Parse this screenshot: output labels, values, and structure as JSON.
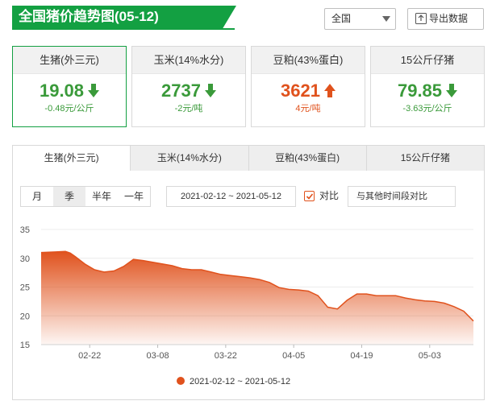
{
  "header": {
    "title": "全国猪价趋势图(05-12)",
    "region": "全国",
    "export_label": "导出数据"
  },
  "cards": [
    {
      "name": "生猪(外三元)",
      "value": "19.08",
      "change": "-0.48元/公斤",
      "direction": "down",
      "color": "#3a9a3a"
    },
    {
      "name": "玉米(14%水分)",
      "value": "2737",
      "change": "-2元/吨",
      "direction": "down",
      "color": "#3a9a3a"
    },
    {
      "name": "豆粕(43%蛋白)",
      "value": "3621",
      "change": "4元/吨",
      "direction": "up",
      "color": "#e0521d"
    },
    {
      "name": "15公斤仔猪",
      "value": "79.85",
      "change": "-3.63元/公斤",
      "direction": "down",
      "color": "#3a9a3a"
    }
  ],
  "tabs": [
    "生猪(外三元)",
    "玉米(14%水分)",
    "豆粕(43%蛋白)",
    "15公斤仔猪"
  ],
  "controls": {
    "periods": [
      "月",
      "季",
      "半年",
      "一年"
    ],
    "active_period": "季",
    "date_range": "2021-02-12 ~ 2021-05-12",
    "compare_label": "对比",
    "compare_checked": true,
    "compare_other": "与其他时间段对比"
  },
  "colors": {
    "brand_green": "#13a042",
    "down_green": "#3a9a3a",
    "up_orange": "#e0521d"
  },
  "chart_data": {
    "type": "area",
    "ylim": [
      15,
      35
    ],
    "yticks": [
      15,
      20,
      25,
      30,
      35
    ],
    "xticks": [
      "02-22",
      "03-08",
      "03-22",
      "04-05",
      "04-19",
      "05-03"
    ],
    "xlim": [
      "2021-02-12",
      "2021-05-12"
    ],
    "grid": "horizontal",
    "legend": "bottom-center",
    "series": [
      {
        "name": "2021-02-12 ~ 2021-05-12",
        "color": "#e0521d",
        "x": [
          "2021-02-12",
          "2021-02-15",
          "2021-02-17",
          "2021-02-18",
          "2021-02-19",
          "2021-02-21",
          "2021-02-23",
          "2021-02-25",
          "2021-02-27",
          "2021-03-01",
          "2021-03-03",
          "2021-03-05",
          "2021-03-07",
          "2021-03-09",
          "2021-03-11",
          "2021-03-13",
          "2021-03-15",
          "2021-03-17",
          "2021-03-19",
          "2021-03-21",
          "2021-03-23",
          "2021-03-25",
          "2021-03-27",
          "2021-03-29",
          "2021-03-31",
          "2021-04-02",
          "2021-04-04",
          "2021-04-06",
          "2021-04-08",
          "2021-04-10",
          "2021-04-12",
          "2021-04-14",
          "2021-04-16",
          "2021-04-18",
          "2021-04-20",
          "2021-04-22",
          "2021-04-24",
          "2021-04-26",
          "2021-04-28",
          "2021-04-30",
          "2021-05-02",
          "2021-05-04",
          "2021-05-06",
          "2021-05-08",
          "2021-05-10",
          "2021-05-12"
        ],
        "values": [
          31.0,
          31.1,
          31.2,
          30.9,
          30.3,
          29.0,
          28.0,
          27.6,
          27.8,
          28.6,
          29.8,
          29.6,
          29.3,
          29.0,
          28.7,
          28.2,
          28.0,
          28.0,
          27.6,
          27.2,
          27.0,
          26.8,
          26.6,
          26.3,
          25.8,
          24.9,
          24.6,
          24.5,
          24.3,
          23.5,
          21.5,
          21.2,
          22.7,
          23.8,
          23.8,
          23.5,
          23.5,
          23.5,
          23.1,
          22.8,
          22.6,
          22.5,
          22.2,
          21.6,
          20.8,
          19.1
        ]
      }
    ]
  }
}
